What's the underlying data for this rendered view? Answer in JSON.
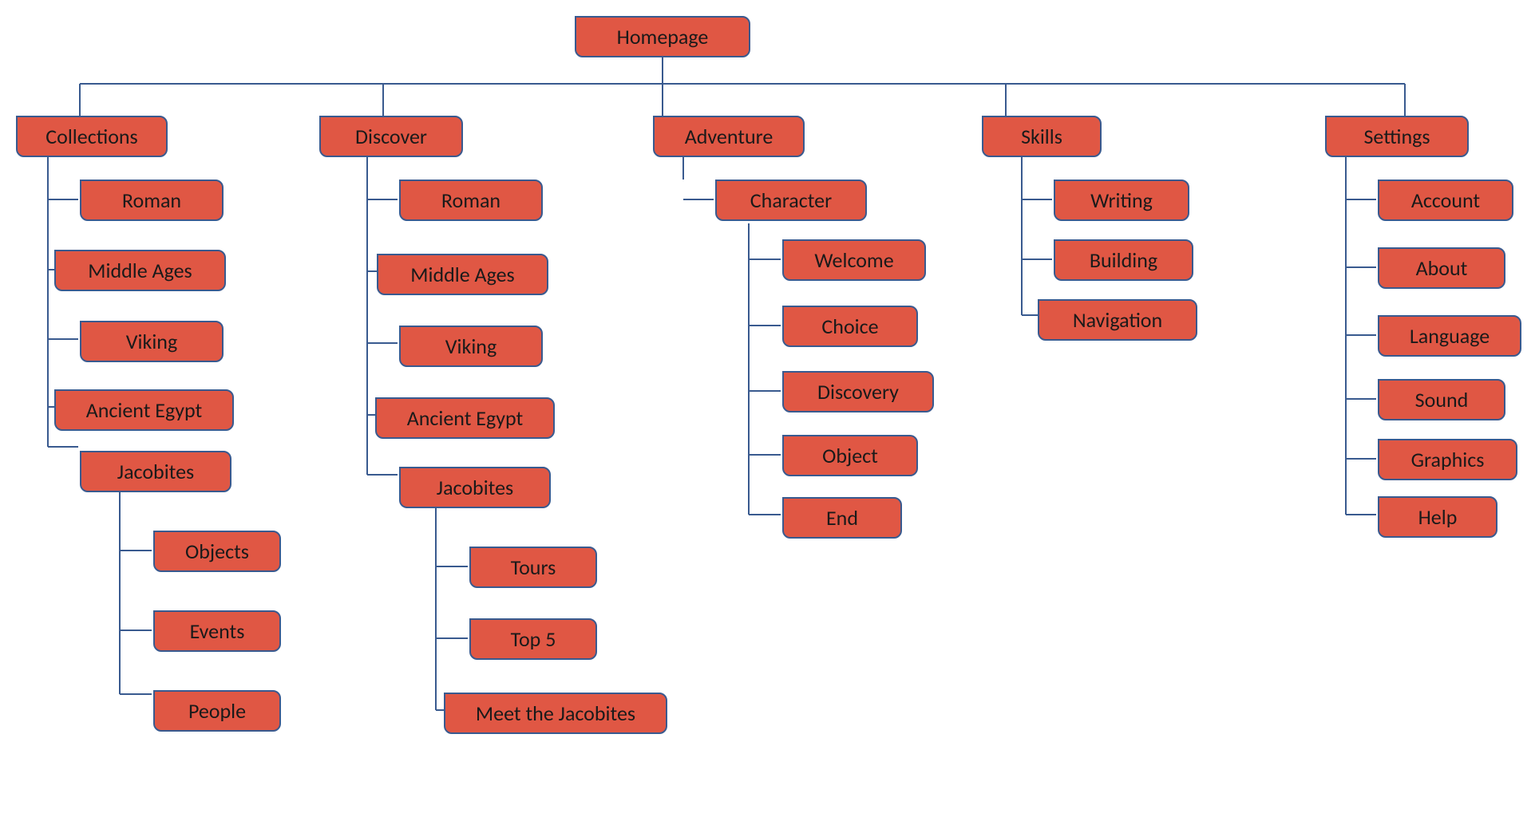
{
  "root": {
    "label": "Homepage"
  },
  "branches": {
    "collections": {
      "label": "Collections",
      "children": {
        "roman": "Roman",
        "middle_ages": "Middle Ages",
        "viking": "Viking",
        "ancient_egypt": "Ancient Egypt",
        "jacobites": {
          "label": "Jacobites",
          "children": {
            "objects": "Objects",
            "events": "Events",
            "people": "People"
          }
        }
      }
    },
    "discover": {
      "label": "Discover",
      "children": {
        "roman": "Roman",
        "middle_ages": "Middle Ages",
        "viking": "Viking",
        "ancient_egypt": "Ancient Egypt",
        "jacobites": {
          "label": "Jacobites",
          "children": {
            "tours": "Tours",
            "top5": "Top 5",
            "meet": "Meet the Jacobites"
          }
        }
      }
    },
    "adventure": {
      "label": "Adventure",
      "children": {
        "character": {
          "label": "Character",
          "children": {
            "welcome": "Welcome",
            "choice": "Choice",
            "discovery": "Discovery",
            "object": "Object",
            "end": "End"
          }
        }
      }
    },
    "skills": {
      "label": "Skills",
      "children": {
        "writing": "Writing",
        "building": "Building",
        "navigation": "Navigation"
      }
    },
    "settings": {
      "label": "Settings",
      "children": {
        "account": "Account",
        "about": "About",
        "language": "Language",
        "sound": "Sound",
        "graphics": "Graphics",
        "help": "Help"
      }
    }
  }
}
